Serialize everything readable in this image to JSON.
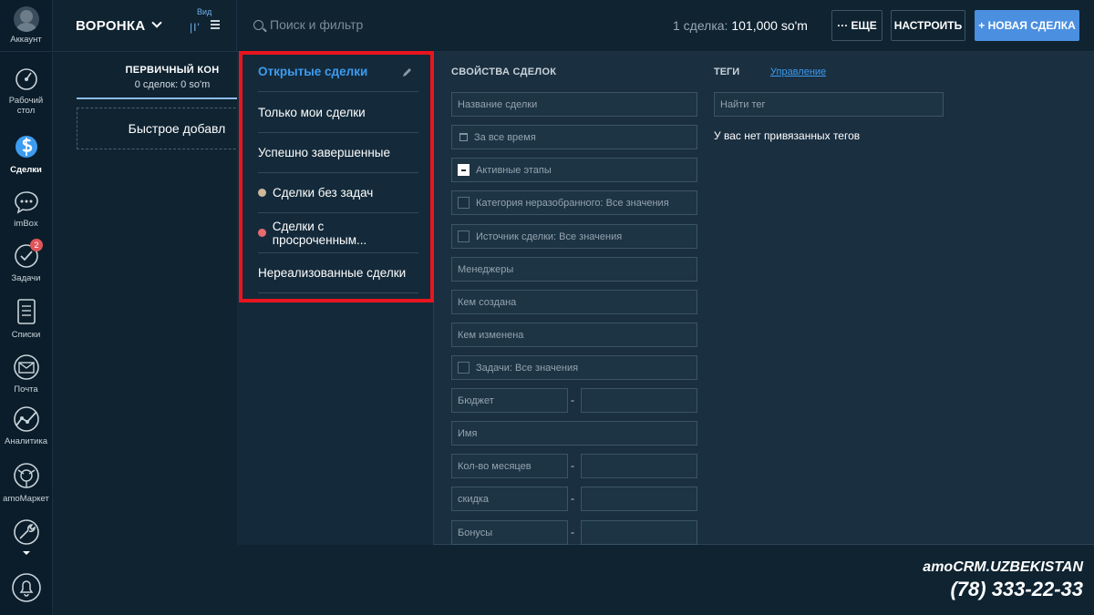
{
  "sidebar": {
    "account_label": "Аккаунт",
    "items": [
      {
        "label": "Рабочий стол",
        "icon": "dashboard-icon"
      },
      {
        "label": "Сделки",
        "icon": "deals-icon"
      },
      {
        "label": "imBox",
        "icon": "chat-icon"
      },
      {
        "label": "Задачи",
        "icon": "tasks-icon",
        "badge": "2"
      },
      {
        "label": "Списки",
        "icon": "lists-icon"
      },
      {
        "label": "Почта",
        "icon": "mail-icon"
      },
      {
        "label": "Аналитика",
        "icon": "analytics-icon"
      },
      {
        "label": "amoМаркет",
        "icon": "market-icon"
      },
      {
        "label": "",
        "icon": "settings-icon"
      }
    ],
    "bottom_icon": "bell-icon"
  },
  "topbar": {
    "pipeline_label": "ВОРОНКА",
    "view_label": "Вид",
    "search_placeholder": "Поиск и фильтр",
    "summary_prefix": "1 сделка:",
    "summary_value": "101,000 so'm",
    "more_button": "··· ЕЩЕ",
    "setup_button": "НАСТРОИТЬ",
    "new_deal_button": "+ НОВАЯ СДЕЛКА"
  },
  "column": {
    "title": "ПЕРВИЧНЫЙ КОН",
    "subtitle": "0 сделок: 0 so'm",
    "quick_add": "Быстрое добавл"
  },
  "presets": [
    {
      "label": "Открытые сделки",
      "active": true
    },
    {
      "label": "Только мои сделки"
    },
    {
      "label": "Успешно завершенные"
    },
    {
      "label": "Сделки без задач",
      "dot_color": "#cdb89a"
    },
    {
      "label": "Сделки с просроченным...",
      "dot_color": "#e86b6f"
    },
    {
      "label": "Нереализованные сделки"
    }
  ],
  "properties": {
    "title": "СВОЙСТВА СДЕЛОК",
    "deal_name": "Название сделки",
    "period": "За все время",
    "active_stages": "Активные этапы",
    "category": "Категория неразобранного: Все значения",
    "source": "Источник сделки: Все значения",
    "managers": "Менеджеры",
    "created_by": "Кем создана",
    "modified_by": "Кем изменена",
    "tasks": "Задачи: Все значения",
    "budget": "Бюджет",
    "name": "Имя",
    "months": "Кол-во месяцев",
    "discount": "скидка",
    "bonuses": "Бонусы",
    "dash": "-"
  },
  "tags": {
    "title": "ТЕГИ",
    "manage_link": "Управление",
    "search_placeholder": "Найти тег",
    "empty_text": "У вас нет привязанных тегов"
  },
  "brand": {
    "line1": "amoCRM.UZBEKISTAN",
    "phone": "(78) 333-22-33"
  },
  "colors": {
    "accent": "#3d9cf0",
    "primary_button": "#4a8fe0",
    "highlight": "#e8151f"
  }
}
